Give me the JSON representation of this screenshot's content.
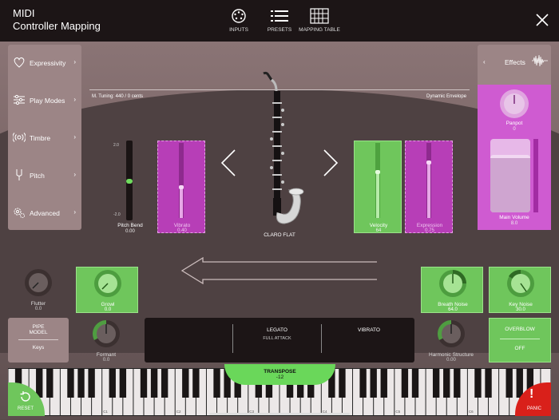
{
  "app": {
    "title_line1": "MIDI",
    "title_line2": "Controller Mapping"
  },
  "nav": [
    {
      "label": "INPUTS",
      "icon": "midi-port-icon"
    },
    {
      "label": "PRESETS",
      "icon": "list-icon"
    },
    {
      "label": "MAPPING TABLE",
      "icon": "table-icon"
    }
  ],
  "left_menu": [
    {
      "label": "Expressivity",
      "icon": "heart-icon"
    },
    {
      "label": "Play Modes",
      "icon": "sliders-icon"
    },
    {
      "label": "Timbre",
      "icon": "wave-icon"
    },
    {
      "label": "Pitch",
      "icon": "tuning-fork-icon"
    },
    {
      "label": "Advanced",
      "icon": "gears-icon"
    }
  ],
  "right_panel": {
    "effects_label": "Effects",
    "panpot_label": "Panpot",
    "panpot_value": "0",
    "mainvol_label": "Main Volume",
    "mainvol_value": "8.0",
    "mainvol_level": 0.78
  },
  "tuning": {
    "text": "M. Tuning: 440   / 0 cents"
  },
  "dynamic_envelope": "Dynamic Envelope",
  "instrument": {
    "name": "CLARO FLAT"
  },
  "sliders": {
    "pitch_bend": {
      "label": "Pitch Bend",
      "value": "0.00",
      "max": "2.0",
      "min": "-2.0",
      "level": 0.5
    },
    "vibrato": {
      "label": "Vibrato",
      "value": "0.40",
      "level": 0.4
    },
    "velocity": {
      "label": "Velocity",
      "value": "64",
      "level": 0.62
    },
    "expression": {
      "label": "Expression",
      "value": "0.75",
      "level": 0.75
    }
  },
  "knobs": {
    "flutter": {
      "label": "Flutter",
      "value": "0.0"
    },
    "growl": {
      "label": "Growl",
      "value": "0.0"
    },
    "breath_noise": {
      "label": "Breath Noise",
      "value": "64.0"
    },
    "key_noise": {
      "label": "Key Noise",
      "value": "30.0"
    },
    "formant": {
      "label": "Formant",
      "value": "0.0"
    },
    "harmonic_structure": {
      "label": "Harmonic Structure",
      "value": "0.00"
    }
  },
  "pipe_model": {
    "title_line1": "PIPE",
    "title_line2": "MODEL",
    "value": "Keys"
  },
  "status": {
    "legato": "LEGATO",
    "legato_sub": "FULL ATTACK",
    "vibrato": "VIBRATO"
  },
  "overblow": {
    "label": "OVERBLOW",
    "value": "OFF"
  },
  "transpose": {
    "label": "TRANSPOSE",
    "value": "-12"
  },
  "reset_label": "RESET",
  "panic_label": "PANIC",
  "octave_labels": [
    "C0",
    "C1",
    "C2",
    "C3",
    "C4",
    "C5",
    "C6",
    "C7"
  ],
  "colors": {
    "green": "#6fc65c",
    "purple": "#b73eb7",
    "magenta": "#cf5bd1",
    "panic": "#d9201a"
  }
}
